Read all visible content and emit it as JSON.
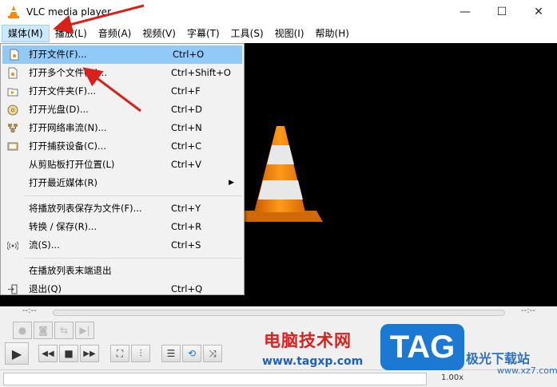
{
  "window": {
    "title": "VLC media player",
    "controls": [
      "—",
      "☐",
      "✕"
    ]
  },
  "menubar": [
    "媒体(M)",
    "播放(L)",
    "音频(A)",
    "视频(V)",
    "字幕(T)",
    "工具(S)",
    "视图(I)",
    "帮助(H)"
  ],
  "media_menu": {
    "group1": [
      {
        "label": "打开文件(F)...",
        "shortcut": "Ctrl+O",
        "icon": "file-icon"
      },
      {
        "label": "打开多个文件(O)...",
        "shortcut": "Ctrl+Shift+O",
        "icon": "files-icon"
      },
      {
        "label": "打开文件夹(F)...",
        "shortcut": "Ctrl+F",
        "icon": "folder-icon"
      },
      {
        "label": "打开光盘(D)...",
        "shortcut": "Ctrl+D",
        "icon": "disc-icon"
      },
      {
        "label": "打开网络串流(N)...",
        "shortcut": "Ctrl+N",
        "icon": "network-icon"
      },
      {
        "label": "打开捕获设备(C)...",
        "shortcut": "Ctrl+C",
        "icon": "capture-icon"
      },
      {
        "label": "从剪贴板打开位置(L)",
        "shortcut": "Ctrl+V"
      },
      {
        "label": "打开最近媒体(R)",
        "shortcut": ""
      }
    ],
    "group2": [
      {
        "label": "将播放列表保存为文件(F)...",
        "shortcut": "Ctrl+Y"
      },
      {
        "label": "转换 / 保存(R)...",
        "shortcut": "Ctrl+R"
      },
      {
        "label": "流(S)...",
        "shortcut": "Ctrl+S",
        "icon": "stream-icon"
      }
    ],
    "group3": [
      {
        "label": "在播放列表末端退出",
        "shortcut": ""
      },
      {
        "label": "退出(Q)",
        "shortcut": "Ctrl+Q",
        "icon": "exit-icon"
      }
    ]
  },
  "seek": {
    "elapsed": "--:--",
    "remaining": "--:--"
  },
  "status": {
    "speed": "1.00x"
  },
  "watermark": {
    "cn": "电脑技术网",
    "url": "www.tagxp.com",
    "tag": "TAG",
    "site": "极光下载站",
    "site2": "www.xz7.com"
  }
}
